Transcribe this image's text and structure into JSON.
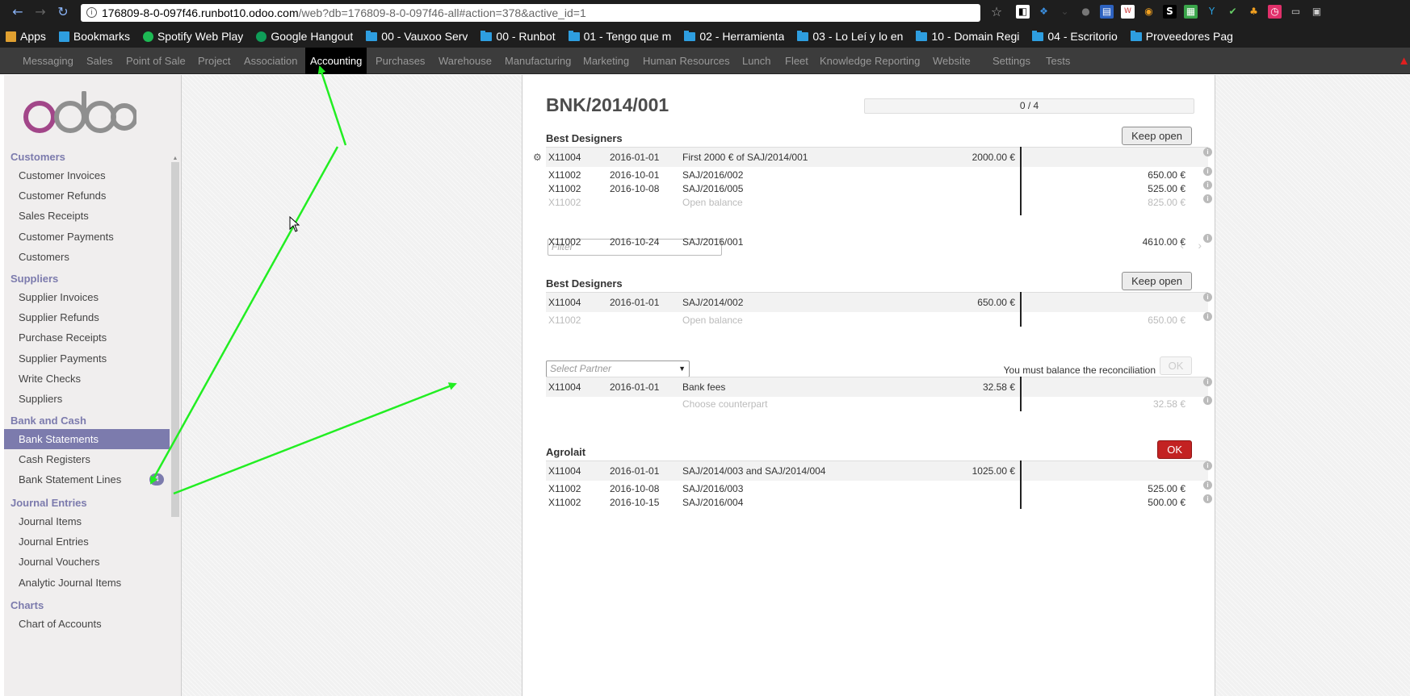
{
  "browser": {
    "url_host": "176809-8-0-097f46.runbot10.odoo.com",
    "url_path": "/web?db=176809-8-0-097f46-all#action=378&active_id=1",
    "bookmarks": [
      {
        "label": "Apps",
        "icon": "apps-grid-icon"
      },
      {
        "label": "Bookmarks",
        "icon": "star-icon"
      },
      {
        "label": "Spotify Web Play",
        "icon": "spotify-icon"
      },
      {
        "label": "Google Hangout",
        "icon": "hangouts-icon"
      },
      {
        "label": "00 - Vauxoo Serv",
        "icon": "folder-icon"
      },
      {
        "label": "00 - Runbot",
        "icon": "folder-icon"
      },
      {
        "label": "01 - Tengo que m",
        "icon": "folder-icon"
      },
      {
        "label": "02 - Herramienta",
        "icon": "folder-icon"
      },
      {
        "label": "03 - Lo Leí y lo en",
        "icon": "folder-icon"
      },
      {
        "label": "10 - Domain Regi",
        "icon": "folder-icon"
      },
      {
        "label": "04 - Escritorio",
        "icon": "folder-icon"
      },
      {
        "label": "Proveedores Pag",
        "icon": "folder-icon"
      }
    ]
  },
  "top_menu": [
    "Messaging",
    "Sales",
    "Point of Sale",
    "Project",
    "Association",
    "Accounting",
    "Purchases",
    "Warehouse",
    "Manufacturing",
    "Marketing",
    "Human Resources",
    "Lunch",
    "Fleet",
    "Knowledge",
    "Reporting",
    "Website",
    "Settings",
    "Tests"
  ],
  "top_menu_active": "Accounting",
  "sidebar": {
    "sections": [
      {
        "title": "Customers",
        "items": [
          "Customer Invoices",
          "Customer Refunds",
          "Sales Receipts",
          "Customer Payments",
          "Customers"
        ]
      },
      {
        "title": "Suppliers",
        "items": [
          "Supplier Invoices",
          "Supplier Refunds",
          "Purchase Receipts",
          "Supplier Payments",
          "Write Checks",
          "Suppliers"
        ]
      },
      {
        "title": "Bank and Cash",
        "items": [
          "Bank Statements",
          "Cash Registers",
          "Bank Statement Lines"
        ]
      },
      {
        "title": "Journal Entries",
        "items": [
          "Journal Items",
          "Journal Entries",
          "Journal Vouchers",
          "Analytic Journal Items"
        ]
      },
      {
        "title": "Charts",
        "items": [
          "Chart of Accounts"
        ]
      }
    ],
    "active_item": "Bank Statements",
    "bank_statement_lines_badge": "4"
  },
  "statement": {
    "title": "BNK/2014/001",
    "progress_text": "0 / 4",
    "progress_done": 0,
    "progress_total": 4,
    "blocks": [
      {
        "partner": "Best Designers",
        "button": "Keep open",
        "head": {
          "account": "X11004",
          "date": "2016-01-01",
          "label": "First 2000 € of SAJ/2014/001",
          "debit": "2000.00 €"
        },
        "lines": [
          {
            "account": "X11002",
            "date": "2016-10-01",
            "label": "SAJ/2016/002",
            "credit": "650.00 €"
          },
          {
            "account": "X11002",
            "date": "2016-10-08",
            "label": "SAJ/2016/005",
            "credit": "525.00 €"
          },
          {
            "account": "X11002",
            "date": "",
            "label": "Open balance",
            "credit": "825.00 €"
          }
        ],
        "filter_placeholder": "Filter",
        "candidate": {
          "account": "X11002",
          "date": "2016-10-24",
          "label": "SAJ/2016/001",
          "credit": "4610.00 €"
        }
      },
      {
        "partner": "Best Designers",
        "button": "Keep open",
        "head": {
          "account": "X11004",
          "date": "2016-01-01",
          "label": "SAJ/2014/002",
          "debit": "650.00 €"
        },
        "lines": [
          {
            "account": "X11002",
            "date": "",
            "label": "Open balance",
            "credit": "650.00 €"
          }
        ]
      },
      {
        "partner_placeholder": "Select Partner",
        "message": "You must balance the reconciliation",
        "button": "OK",
        "head": {
          "account": "X11004",
          "date": "2016-01-01",
          "label": "Bank fees",
          "debit": "32.58 €"
        },
        "lines": [
          {
            "account": "",
            "date": "",
            "label": "Choose counterpart",
            "credit": "32.58 €"
          }
        ]
      },
      {
        "partner": "Agrolait",
        "button": "OK",
        "head": {
          "account": "X11004",
          "date": "2016-01-01",
          "label": "SAJ/2014/003 and SAJ/2014/004",
          "debit": "1025.00 €"
        },
        "lines": [
          {
            "account": "X11002",
            "date": "2016-10-08",
            "label": "SAJ/2016/003",
            "credit": "525.00 €"
          },
          {
            "account": "X11002",
            "date": "2016-10-15",
            "label": "SAJ/2016/004",
            "credit": "500.00 €"
          }
        ]
      }
    ]
  },
  "colors": {
    "accent": "#7c7bad",
    "danger": "#c32222",
    "annotation_arrow": "#22ee22"
  }
}
